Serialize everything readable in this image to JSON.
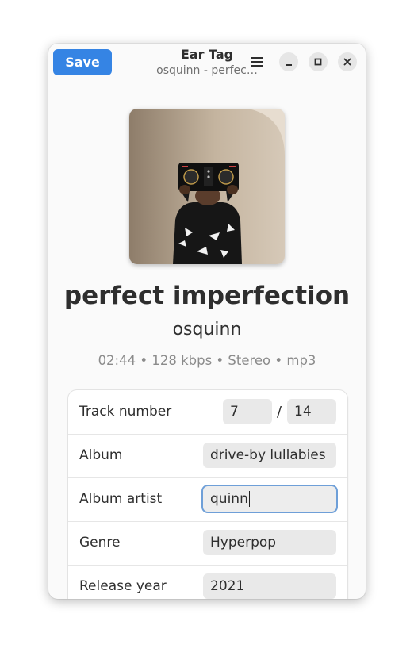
{
  "header": {
    "save_label": "Save",
    "title": "Ear Tag",
    "subtitle": "osquinn - perfec…"
  },
  "cover_art": {
    "description": "album cover photo",
    "bg_color": "#b8a792"
  },
  "song": {
    "title": "perfect imperfection",
    "artist": "osquinn",
    "info": "02:44 • 128 kbps • Stereo • mp3"
  },
  "fields": {
    "track_number": {
      "label": "Track number",
      "number": "7",
      "separator": "/",
      "total": "14"
    },
    "album": {
      "label": "Album",
      "value": "drive-by lullabies"
    },
    "album_artist": {
      "label": "Album artist",
      "value": "quinn"
    },
    "genre": {
      "label": "Genre",
      "value": "Hyperpop"
    },
    "release_year": {
      "label": "Release year",
      "value": "2021"
    }
  },
  "colors": {
    "accent": "#3584e4",
    "focus_ring": "#6e9fd8"
  },
  "icons": [
    "hamburger-menu-icon",
    "minimize-icon",
    "maximize-icon",
    "close-icon"
  ]
}
